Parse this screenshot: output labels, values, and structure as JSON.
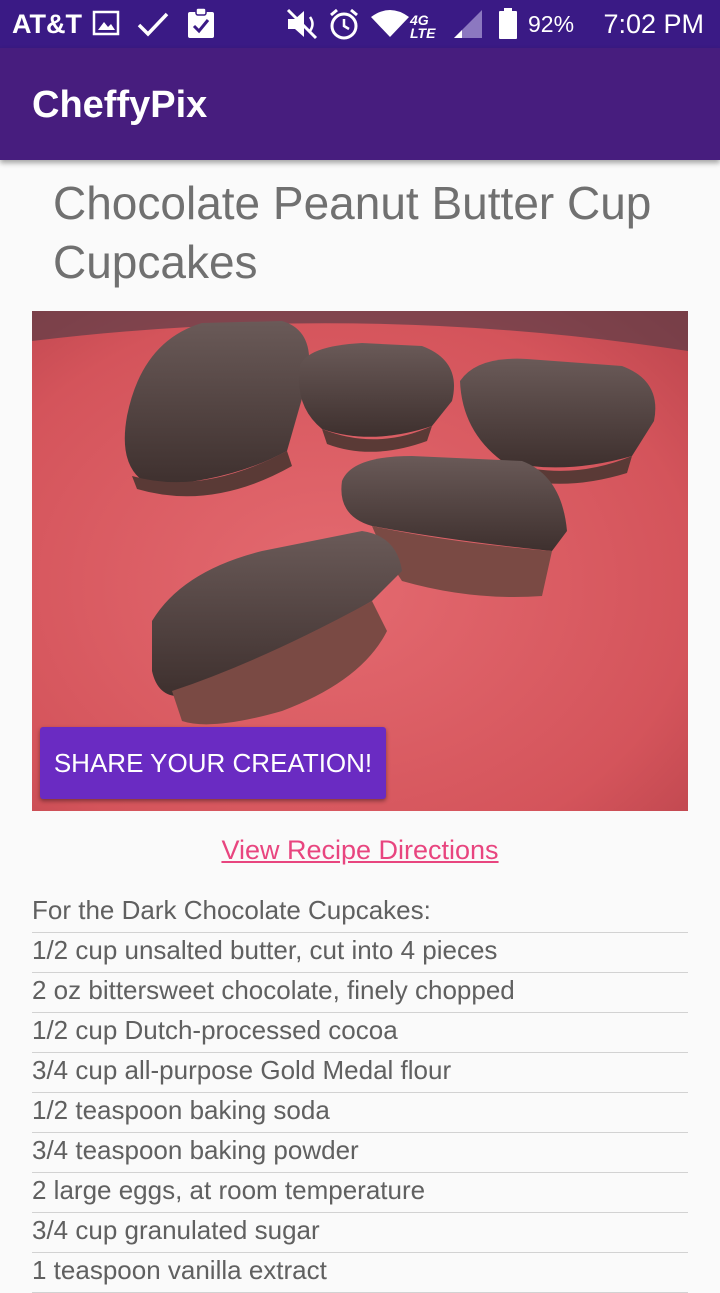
{
  "status_bar": {
    "carrier": "AT&T",
    "battery": "92%",
    "time": "7:02 PM",
    "network": "4G LTE",
    "icons": [
      "image-icon",
      "check-icon",
      "clipboard-check-icon",
      "mute-icon",
      "alarm-icon",
      "wifi-icon",
      "signal-icon",
      "battery-icon"
    ]
  },
  "app_bar": {
    "title": "CheffyPix"
  },
  "recipe": {
    "title": "Chocolate Peanut Butter Cup Cupcakes",
    "photo_description_icon": "recipe-photo",
    "share_label": "SHARE YOUR CREATION!",
    "directions_link": "View Recipe Directions",
    "ingredients": [
      "For the Dark Chocolate Cupcakes:",
      "1/2 cup unsalted butter, cut into 4 pieces",
      "2 oz bittersweet chocolate, finely chopped",
      "1/2 cup Dutch-processed cocoa",
      "3/4 cup all-purpose Gold Medal flour",
      "1/2 teaspoon baking soda",
      "3/4 teaspoon baking powder",
      "2 large eggs, at room temperature",
      "3/4 cup granulated sugar",
      "1 teaspoon vanilla extract"
    ]
  },
  "colors": {
    "status_bar": "#3a1a85",
    "app_bar": "#471d7e",
    "accent_button": "#6a2bc2",
    "link": "#e8457f",
    "plate": "#d9545a"
  }
}
